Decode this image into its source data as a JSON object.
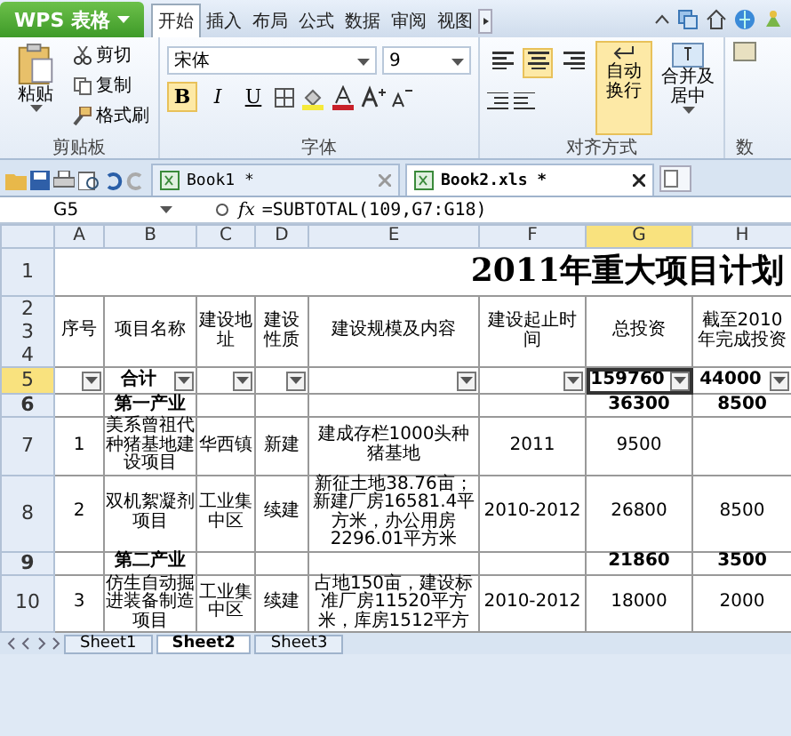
{
  "app_menu": {
    "label": "WPS 表格"
  },
  "ribbon_tabs": [
    {
      "label": "开始",
      "selected": true
    },
    {
      "label": "插入",
      "selected": false
    },
    {
      "label": "布局",
      "selected": false
    },
    {
      "label": "公式",
      "selected": false
    },
    {
      "label": "数据",
      "selected": false
    },
    {
      "label": "审阅",
      "selected": false
    },
    {
      "label": "视图",
      "selected": false
    }
  ],
  "clipboard": {
    "paste": "粘贴",
    "cut": "剪切",
    "copy": "复制",
    "format_painter": "格式刷",
    "label": "剪贴板"
  },
  "font": {
    "name": "宋体",
    "size": "9",
    "label": "字体"
  },
  "format_buttons": [
    {
      "kind": "bold",
      "label": "B",
      "on": true
    },
    {
      "kind": "italic",
      "label": "I",
      "on": false
    },
    {
      "kind": "underline",
      "label": "U",
      "on": false
    }
  ],
  "align_buttons": [
    {
      "kind": "left",
      "selected": false
    },
    {
      "kind": "center",
      "selected": true
    },
    {
      "kind": "right",
      "selected": false
    }
  ],
  "alignment": {
    "wrap": "自动换行",
    "wrap_on": true,
    "merge": "合并及居中",
    "label": "对齐方式"
  },
  "number_group": {
    "label": "数"
  },
  "doc_tabs": [
    {
      "label": "Book1 *",
      "selected": false
    },
    {
      "label": "Book2.xls *",
      "selected": true
    }
  ],
  "formula_bar": {
    "cell": "G5",
    "fx": "fx",
    "formula": "=SUBTOTAL(109,G7:G18)"
  },
  "columns": [
    {
      "label": "A",
      "selected": false
    },
    {
      "label": "B",
      "selected": false
    },
    {
      "label": "C",
      "selected": false
    },
    {
      "label": "D",
      "selected": false
    },
    {
      "label": "E",
      "selected": false
    },
    {
      "label": "F",
      "selected": false
    },
    {
      "label": "G",
      "selected": true
    },
    {
      "label": "H",
      "selected": false
    }
  ],
  "title_row": {
    "number": "1",
    "title": "2011年重大项目计划"
  },
  "header_rows": {
    "numbers": [
      "2",
      "3",
      "4"
    ],
    "cells": [
      "序号",
      "项目名称",
      "建设地址",
      "建设性质",
      "建设规模及内容",
      "建设起止时间",
      "总投资",
      "截至2010年完成投资"
    ]
  },
  "filter_row": {
    "number": "5",
    "selected": true,
    "cells": {
      "B": "合计",
      "G": "159760",
      "H": "44000"
    }
  },
  "rows": [
    {
      "number": "6",
      "kind": "group",
      "cells": {
        "B": "第一产业",
        "G": "36300",
        "H": "8500"
      }
    },
    {
      "number": "7",
      "kind": "item",
      "cells": {
        "A": "1",
        "B": "美系曾祖代种猪基地建设项目",
        "C": "华西镇",
        "D": "新建",
        "E": "建成存栏1000头种猪基地",
        "F": "2011",
        "G": "9500"
      }
    },
    {
      "number": "8",
      "kind": "item",
      "cells": {
        "A": "2",
        "B": "双机絮凝剂项目",
        "C": "工业集中区",
        "D": "续建",
        "E": "新征土地38.76亩；新建厂房16581.4平方米，办公用房2296.01平方米",
        "F": "2010-2012",
        "G": "26800",
        "H": "8500"
      }
    },
    {
      "number": "9",
      "kind": "group",
      "cells": {
        "B": "第二产业",
        "G": "21860",
        "H": "3500"
      }
    },
    {
      "number": "10",
      "kind": "item",
      "cells": {
        "A": "3",
        "B": "仿生自动掘进装备制造项目",
        "C": "工业集中区",
        "D": "续建",
        "E": "占地150亩，建设标准厂房11520平方米，库房1512平方",
        "F": "2010-2012",
        "G": "18000",
        "H": "2000"
      }
    }
  ],
  "sheet_tabs": [
    {
      "label": "Sheet1",
      "selected": false
    },
    {
      "label": "Sheet2",
      "selected": true
    },
    {
      "label": "Sheet3",
      "selected": false
    }
  ]
}
